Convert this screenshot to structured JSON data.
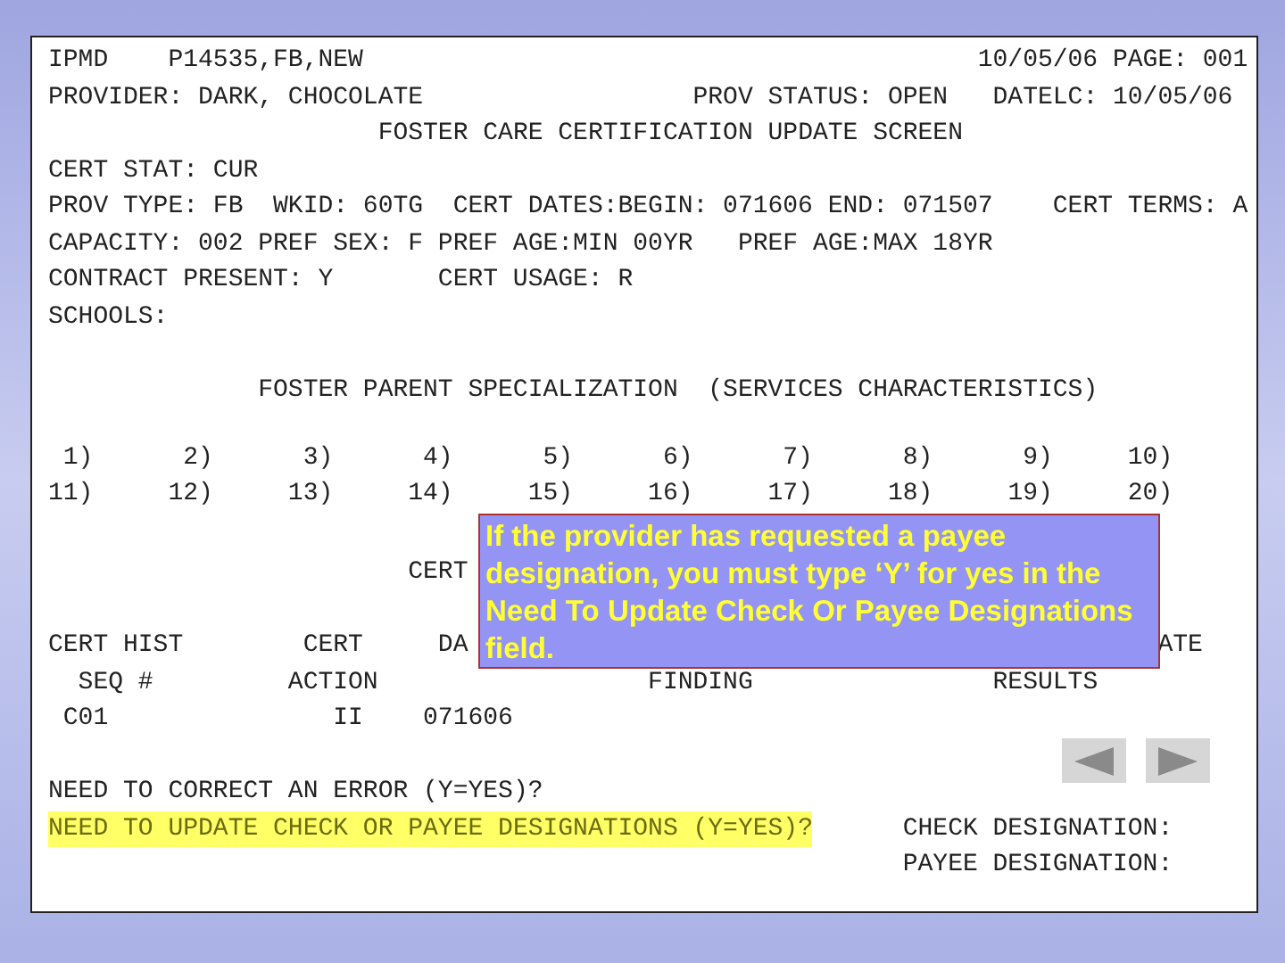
{
  "screen": {
    "lines": [
      {
        "segments": [
          "IPMD",
          "P14535,FB,NEW",
          "10/05/06 PAGE: 001"
        ],
        "highlighted": false
      },
      {
        "segments": [
          "PROVIDER: DARK, CHOCOLATE",
          "PROV STATUS: OPEN",
          "DATELC: 10/05/06"
        ],
        "highlighted": false
      },
      {
        "segments": [
          "FOSTER CARE CERTIFICATION UPDATE SCREEN"
        ],
        "highlighted": false
      },
      {
        "segments": [
          "CERT STAT: CUR"
        ],
        "highlighted": false
      },
      {
        "segments": [
          "PROV TYPE: FB",
          "WKID: 60TG",
          "CERT DATES:BEGIN: 071606",
          "END: 071507",
          "CERT TERMS: A"
        ],
        "highlighted": false
      },
      {
        "segments": [
          "CAPACITY: 002",
          "PREF SEX: F",
          "PREF AGE:MIN 00YR",
          "PREF AGE:MAX 18YR"
        ],
        "highlighted": false
      },
      {
        "segments": [
          "CONTRACT PRESENT: Y",
          "CERT USAGE: R"
        ],
        "highlighted": false
      },
      {
        "segments": [
          "SCHOOLS:"
        ],
        "highlighted": false
      },
      {
        "segments": [
          "FOSTER PARENT SPECIALIZATION",
          "(SERVICES CHARACTERISTICS)"
        ],
        "highlighted": false
      },
      {
        "kind": "slots",
        "segments": [
          "1)",
          "2)",
          "3)",
          "4)",
          "5)",
          "6)",
          "7)",
          "8)",
          "9)",
          "10)"
        ],
        "highlighted": false
      },
      {
        "kind": "slots",
        "segments": [
          "11)",
          "12)",
          "13)",
          "14)",
          "15)",
          "16)",
          "17)",
          "18)",
          "19)",
          "20)"
        ],
        "highlighted": false
      },
      {
        "segments": [
          "CERT"
        ],
        "highlighted": false
      },
      {
        "segments": [
          "CERT HIST",
          "CERT",
          "DA",
          "ATE"
        ],
        "highlighted": false
      },
      {
        "segments": [
          "SEQ #",
          "ACTION",
          "FINDING",
          "RESULTS"
        ],
        "highlighted": false
      },
      {
        "segments": [
          "C01",
          "II",
          "071606"
        ],
        "highlighted": false
      },
      {
        "segments": [
          "NEED TO CORRECT AN ERROR (Y=YES)?"
        ],
        "highlighted": false
      },
      {
        "segments": [
          "NEED TO UPDATE CHECK OR PAYEE DESIGNATIONS (Y=YES)?",
          "CHECK DESIGNATION:"
        ],
        "highlighted": true
      },
      {
        "segments": [
          "PAYEE DESIGNATION:"
        ],
        "highlighted": false
      }
    ]
  },
  "callout": {
    "text": "If the provider has requested a payee designation, you must type ‘Y’ for yes in the Need To Update Check Or Payee Designations field."
  }
}
